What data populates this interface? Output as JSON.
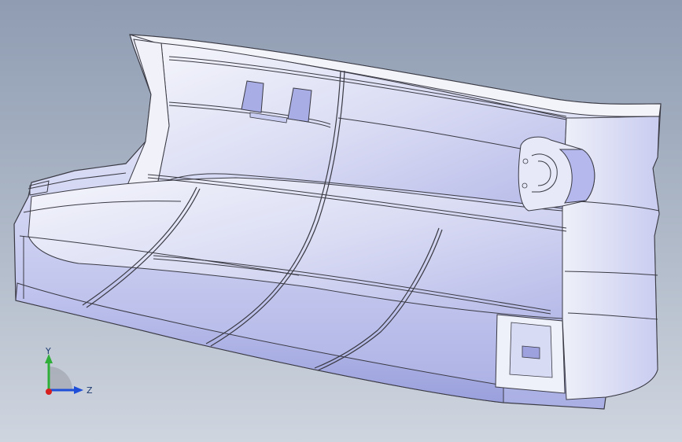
{
  "viewport": {
    "background_top": "#8f9cb2",
    "background_bottom": "#cfd5df"
  },
  "model": {
    "body_color": "#d9dcf6",
    "shade_color": "#9ea4e0",
    "edge_color": "#3a3a44"
  },
  "triad": {
    "y_label": "Y",
    "z_label": "Z",
    "y_color": "#2fae3a",
    "z_color": "#1f4fd8",
    "x_color": "#d61f1f"
  }
}
